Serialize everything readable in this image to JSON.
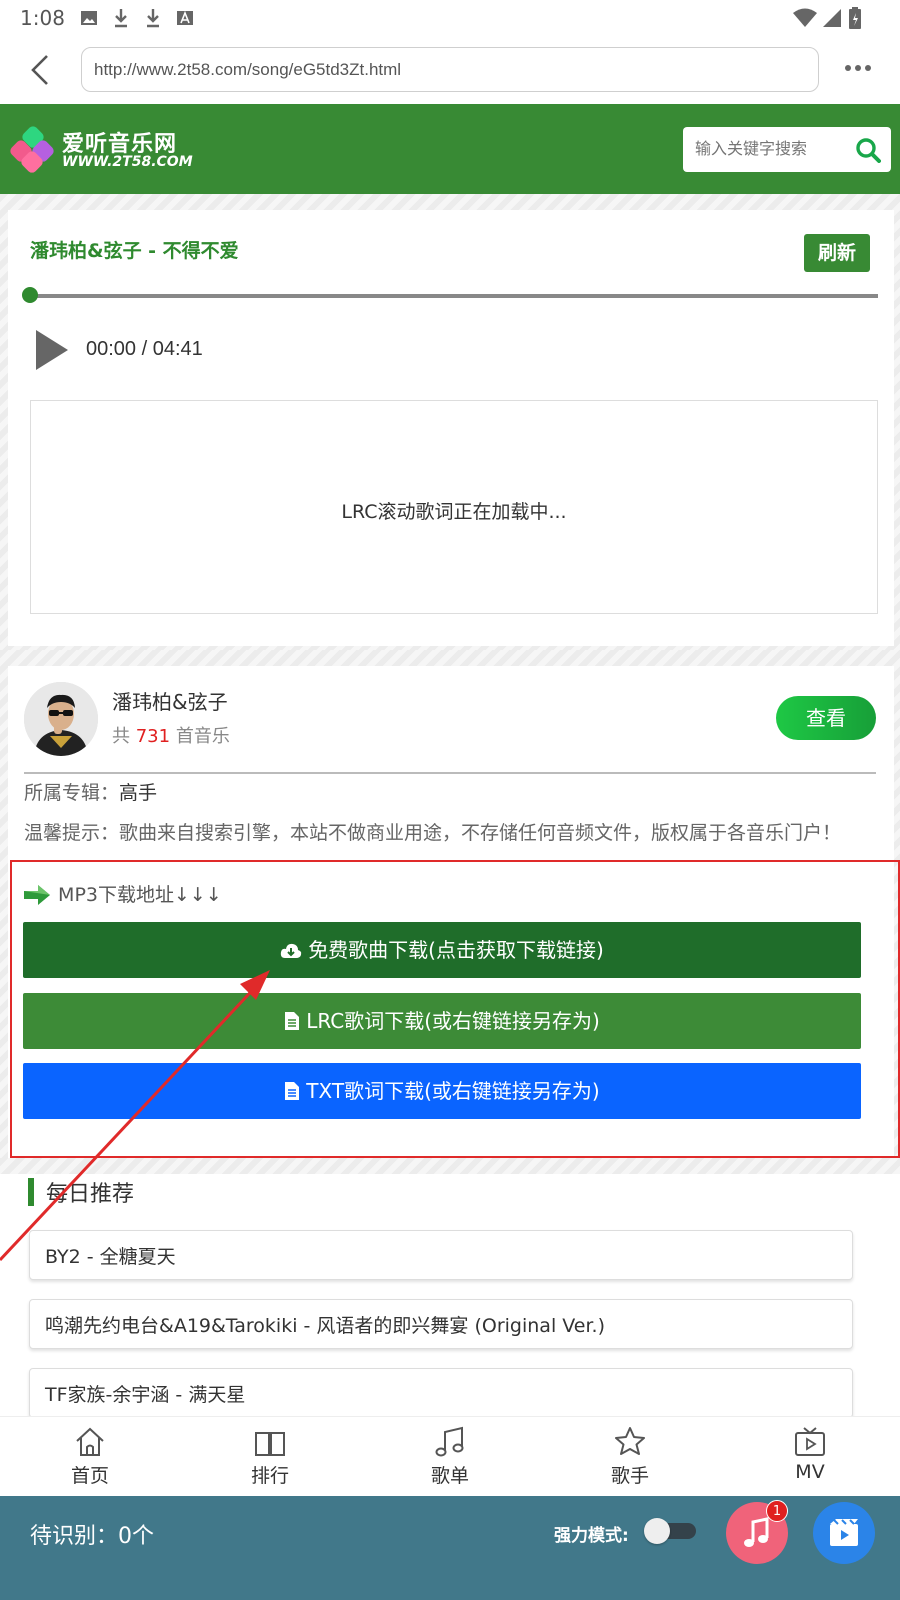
{
  "status_bar": {
    "time": "1:08"
  },
  "browser": {
    "url": "http://www.2t58.com/song/eG5td3Zt.html"
  },
  "site": {
    "logo_title": "爱听音乐网",
    "logo_subtitle": "WWW.2T58.COM",
    "search_placeholder": "输入关键字搜索"
  },
  "player": {
    "song_title": "潘玮柏&弦子 - 不得不爱",
    "refresh_label": "刷新",
    "progress_fraction": 0,
    "time": "00:00 / 04:41",
    "lyric_status": "LRC滚动歌词正在加载中..."
  },
  "artist": {
    "name": "潘玮柏&弦子",
    "count_prefix": "共",
    "count": "731",
    "count_suffix": "首音乐",
    "view_label": "查看"
  },
  "album": {
    "label": "所属专辑：",
    "name": "高手"
  },
  "notice": "温馨提示：歌曲来自搜索引擎，本站不做商业用途，不存储任何音频文件，版权属于各音乐门户！",
  "download": {
    "title": "MP3下载地址↓↓↓",
    "free_label": "免费歌曲下载(点击获取下载链接)",
    "lrc_label": "LRC歌词下载(或右键链接另存为)",
    "txt_label": "TXT歌词下载(或右键链接另存为)"
  },
  "recommend": {
    "title": "每日推荐",
    "items": [
      "BY2 - 全糖夏天",
      "鸣潮先约电台&A19&Tarokiki - 风语者的即兴舞宴 (Original Ver.)",
      "TF家族-余宇涵 - 满天星"
    ]
  },
  "nav": {
    "home": "首页",
    "rank": "排行",
    "playlist": "歌单",
    "singer": "歌手",
    "mv": "MV"
  },
  "bottom_bar": {
    "pending": "待识别：0个",
    "force_mode": "强力模式:",
    "badge": "1"
  },
  "colors": {
    "header_green": "#388a34",
    "free_button": "#1f6d2a",
    "lrc_button": "#3d8b37",
    "txt_button": "#0a64ff",
    "bottom_bar": "#41788a",
    "annotation_red": "#e02a2a"
  }
}
